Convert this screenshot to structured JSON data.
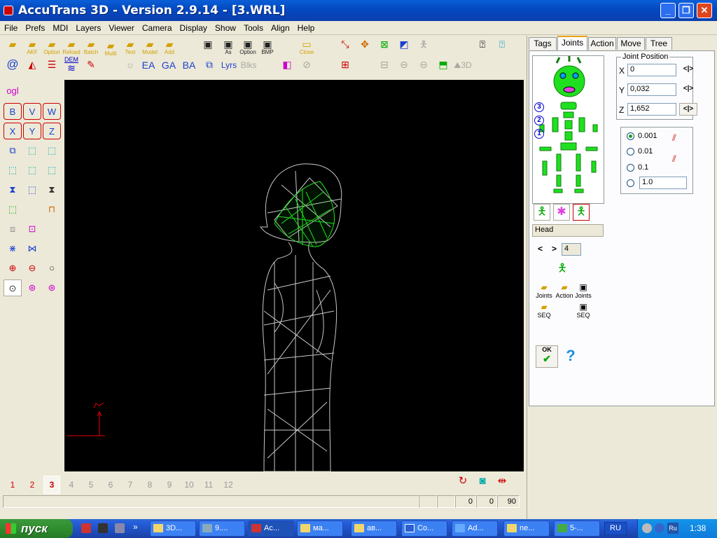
{
  "window": {
    "title": "AccuTrans 3D - Version 2.9.14 - [3.WRL]",
    "minimize_label": "_",
    "restore_label": "❐",
    "close_label": "✕"
  },
  "menu": [
    "File",
    "Prefs",
    "MDI",
    "Layers",
    "Viewer",
    "Camera",
    "Display",
    "Show",
    "Tools",
    "Align",
    "Help"
  ],
  "toolbar_row1": [
    "AKF",
    "Option",
    "Reload",
    "Batch",
    "Multi",
    "Text",
    "Model",
    "Add",
    "As",
    "Option",
    "BMP",
    "Close"
  ],
  "toolbar_row2": [
    "DEM",
    "EA",
    "GA",
    "BA",
    "Lyrs",
    "Blks",
    "3D"
  ],
  "left_toolbar": {
    "ogl_label": "ogl",
    "axis_buttons": [
      "B",
      "V",
      "W",
      "X",
      "Y",
      "Z"
    ]
  },
  "viewport": {
    "axis_label_x": "x",
    "axis_label_y": "y"
  },
  "pages": {
    "items": [
      "1",
      "2",
      "3",
      "4",
      "5",
      "6",
      "7",
      "8",
      "9",
      "10",
      "11",
      "12"
    ],
    "selected": "3"
  },
  "status": {
    "values": [
      "0",
      "0",
      "90"
    ]
  },
  "tabs": [
    "Tags",
    "Joints",
    "Action",
    "Move",
    "Tree"
  ],
  "active_tab": "Joints",
  "joint_position": {
    "title": "Joint Position",
    "x_label": "X",
    "x_value": "0",
    "y_label": "Y",
    "y_value": "0,032",
    "z_label": "Z",
    "z_value": "1,652",
    "arrow_label": "<|>"
  },
  "step": {
    "options": [
      "0.001",
      "0.01",
      "0.1"
    ],
    "custom_value": "1.0",
    "selected": "0.001"
  },
  "joints": {
    "levels": [
      "3",
      "2",
      "1"
    ],
    "joint_name": "Head",
    "nav_prev": "<",
    "nav_next": ">",
    "index_value": "4",
    "load_joints": "Joints",
    "load_action": "Action",
    "save_joints": "Joints",
    "load_seq": "SEQ",
    "save_seq": "SEQ",
    "ok_label": "OK",
    "help_label": "?"
  },
  "taskbar": {
    "start_label": "пуск",
    "tasks": [
      "3D...",
      "9....",
      "Ac...",
      "ма...",
      "ав...",
      "Co...",
      "Ad...",
      "ne...",
      "5-..."
    ],
    "lang": "RU",
    "clock": "1:38"
  },
  "colors": {
    "accent_green": "#1fe01f",
    "viewport_bg": "#000000",
    "wire_grey": "#c8c8c8"
  }
}
